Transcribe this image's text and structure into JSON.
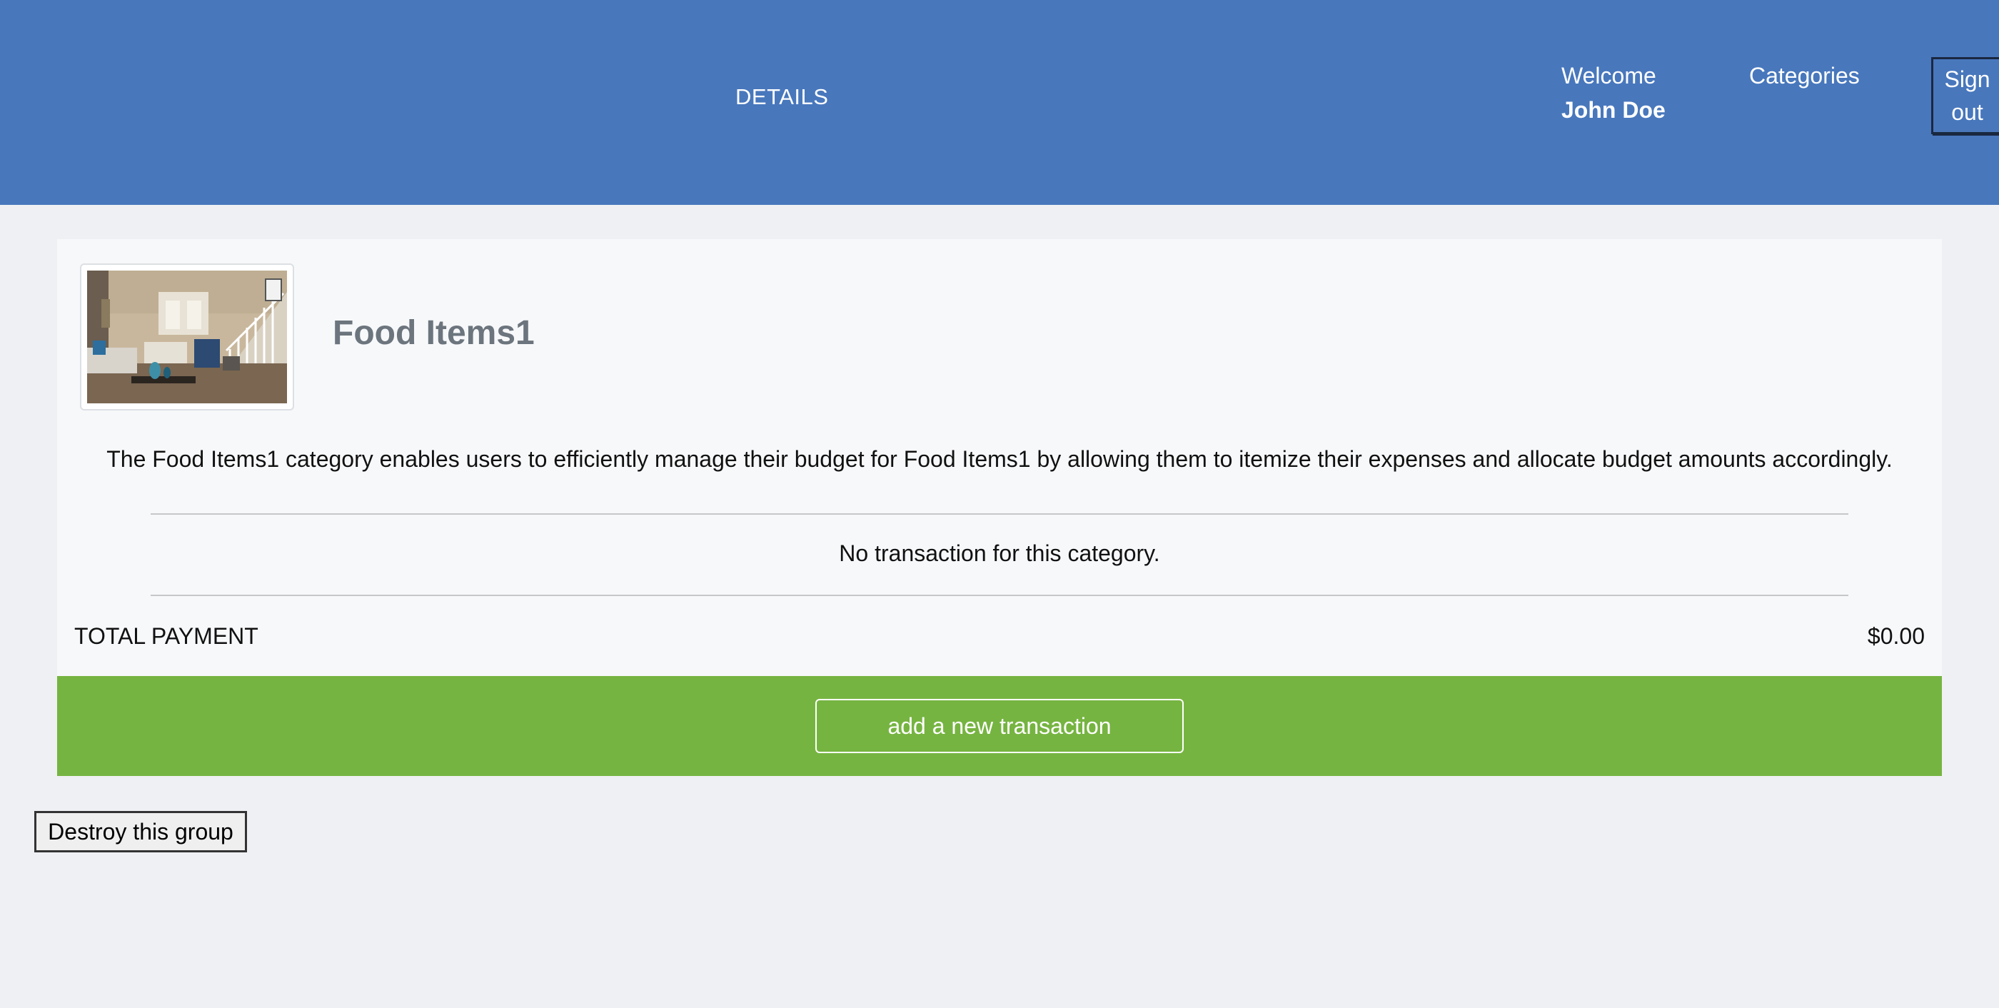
{
  "header": {
    "title": "DETAILS",
    "welcome_label": "Welcome",
    "user_name": "John Doe",
    "categories_link": "Categories",
    "signout_label": "Sign out"
  },
  "category": {
    "name": "Food Items1",
    "image_alt": "living room photo",
    "description": "The Food Items1 category enables users to efficiently manage their budget for Food Items1 by allowing them to itemize their expenses and allocate budget amounts accordingly.",
    "empty_message": "No transaction for this category.",
    "total_label": "TOTAL PAYMENT",
    "total_value": "$0.00"
  },
  "actions": {
    "add_transaction": "add a new transaction",
    "destroy_group": "Destroy this group"
  },
  "colors": {
    "header_bg": "#4877bc",
    "action_bar_bg": "#76b441",
    "page_bg": "#eff0f3",
    "card_bg": "#f7f8fa"
  }
}
